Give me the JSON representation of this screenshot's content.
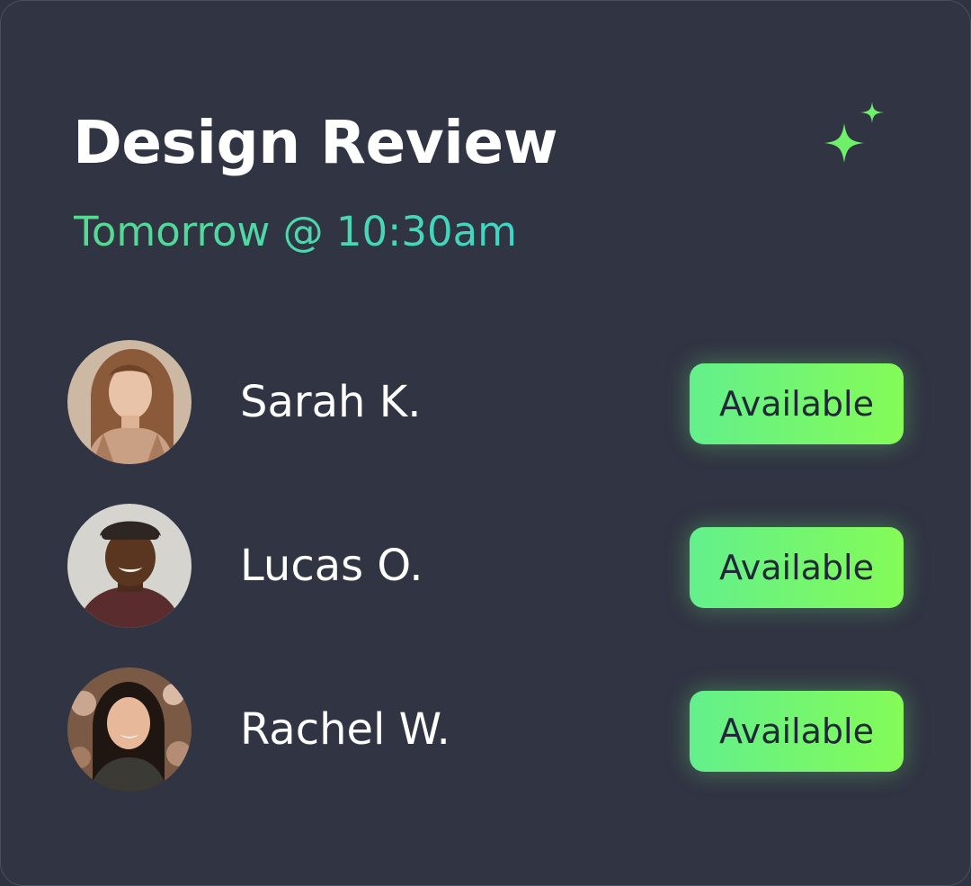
{
  "card": {
    "title": "Design Review",
    "subtitle": "Tomorrow @ 10:30am",
    "icon": "sparkle-icon"
  },
  "attendees": [
    {
      "name": "Sarah K.",
      "status": "Available",
      "avatar": "avatar-photo-woman-light-hair"
    },
    {
      "name": "Lucas O.",
      "status": "Available",
      "avatar": "avatar-photo-man-cap"
    },
    {
      "name": "Rachel W.",
      "status": "Available",
      "avatar": "avatar-photo-woman-dark-hair"
    }
  ],
  "colors": {
    "background": "#313443",
    "title": "#ffffff",
    "subtitle_start": "#57d98f",
    "subtitle_end": "#3fd6c6",
    "badge_start": "#63f08c",
    "badge_end": "#84fb57",
    "badge_text": "#22283a",
    "sparkle": "#6ef06a"
  }
}
